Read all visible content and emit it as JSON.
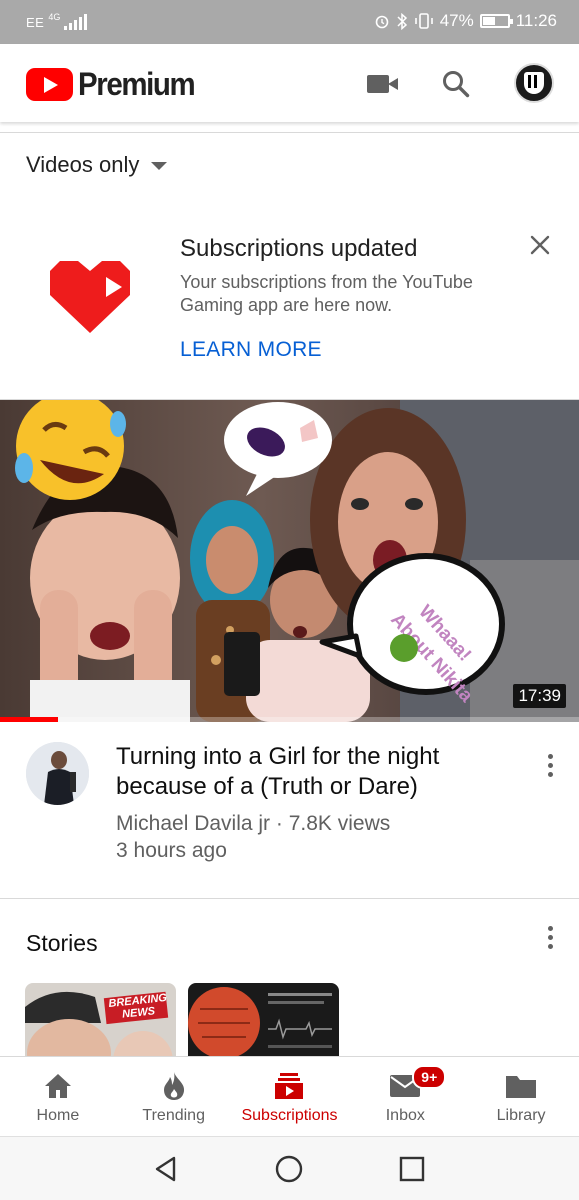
{
  "status_bar": {
    "carrier": "EE",
    "network": "4G",
    "battery": "47%",
    "battery_level": 0.47,
    "time": "11:26"
  },
  "app_bar": {
    "brand": "Premium",
    "icons": [
      "video-camera-icon",
      "search-icon",
      "account-avatar"
    ]
  },
  "filter": {
    "label": "Videos only"
  },
  "promo": {
    "title": "Subscriptions updated",
    "body": "Your subscriptions from the YouTube Gaming app are here now.",
    "link": "LEARN MORE"
  },
  "video": {
    "duration": "17:39",
    "watch_progress": 0.1,
    "thumbnail_bubble": "Whaaa! About Nikita",
    "title": "Turning into a Girl for the night because of a (Truth or Dare)",
    "meta_line": "Michael Davila jr · 7.8K views",
    "age": "3 hours ago"
  },
  "stories": {
    "title": "Stories",
    "items": [
      {
        "badge": "BREAKING NEWS"
      },
      {
        "badge": ""
      }
    ]
  },
  "bottom_nav": {
    "items": [
      {
        "label": "Home",
        "icon": "home-icon"
      },
      {
        "label": "Trending",
        "icon": "flame-icon"
      },
      {
        "label": "Subscriptions",
        "icon": "subscriptions-icon",
        "active": true
      },
      {
        "label": "Inbox",
        "icon": "inbox-icon",
        "badge": "9+"
      },
      {
        "label": "Library",
        "icon": "folder-icon"
      }
    ]
  },
  "colors": {
    "brand_red": "#ff0000",
    "active_red": "#cc0000",
    "link_blue": "#065fd4",
    "text_secondary": "#606060",
    "status_bar": "#a9a9a9"
  }
}
